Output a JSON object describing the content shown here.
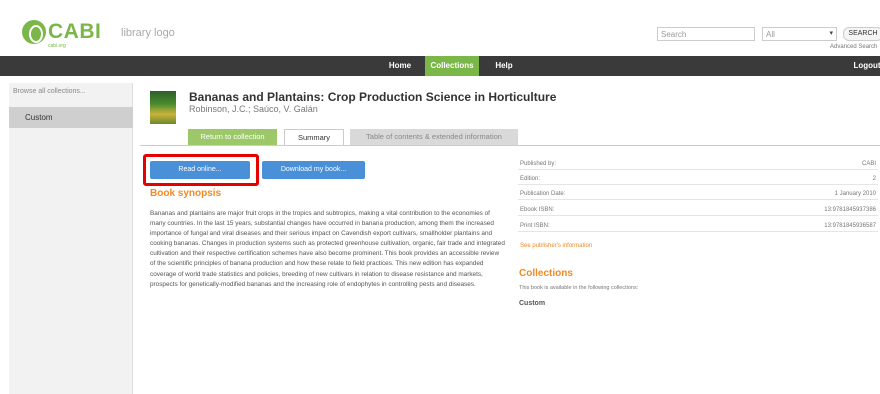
{
  "header": {
    "logo_text": "CABI",
    "logo_sub": "cabi.org",
    "library_logo": "library logo",
    "search_placeholder": "Search",
    "search_scope": "All",
    "search_caret": "▾",
    "search_button": "SEARCH",
    "advanced_search": "Advanced Search"
  },
  "nav": {
    "home": "Home",
    "collections": "Collections",
    "help": "Help",
    "logout": "Logout"
  },
  "sidebar": {
    "browse_link": "Browse all collections...",
    "item": "Custom"
  },
  "book": {
    "title": "Bananas and Plantains: Crop Production Science in Horticulture",
    "authors": "Robinson, J.C.; Saúco, V. Galán"
  },
  "tabs": {
    "return": "Return to collection",
    "summary": "Summary",
    "toc": "Table of contents & extended information"
  },
  "buttons": {
    "read_online": "Read online...",
    "download": "Download my book..."
  },
  "synopsis": {
    "title": "Book synopsis",
    "text": "Bananas and plantains are major fruit crops in the tropics and subtropics, making a vital contribution to the economies of many countries. In the last 15 years, substantial changes have occurred in banana production, among them the increased importance of fungal and viral diseases and their serious impact on Cavendish export cultivars, smallholder plantains and cooking bananas. Changes in production systems such as protected greenhouse cultivation, organic, fair trade and integrated cultivation and their respective certification schemes have also become prominent. This book provides an accessible review of the scientific principles of banana production and how these relate to field practices. This new edition has expanded coverage of world trade statistics and policies, breeding of new cultivars in relation to disease resistance and markets, prospects for genetically-modified bananas and the increasing role of endophytes in controlling pests and diseases."
  },
  "details": {
    "rows": [
      {
        "k": "Published by:",
        "v": "CABI"
      },
      {
        "k": "Edition:",
        "v": "2"
      },
      {
        "k": "Publication Date:",
        "v": "1 January 2010"
      },
      {
        "k": "Ebook ISBN:",
        "v": "13:9781845937386"
      },
      {
        "k": "Print ISBN:",
        "v": "13:9781845936587"
      }
    ],
    "link": "See publisher's information"
  },
  "collections": {
    "title": "Collections",
    "desc": "This book is available in the following collections:",
    "item": "Custom"
  },
  "colors": {
    "brand_green": "#7ab648",
    "accent_orange": "#f08a24",
    "button_blue": "#4a90d9",
    "highlight_red": "#e60000"
  }
}
